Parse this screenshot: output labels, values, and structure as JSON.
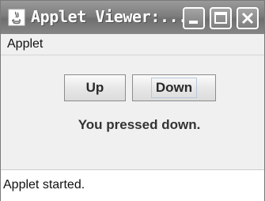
{
  "window": {
    "title": "Applet Viewer:...",
    "controls": {
      "minimize": "minimize-icon",
      "maximize": "maximize-icon",
      "close": "close-icon"
    }
  },
  "menubar": {
    "items": [
      {
        "label": "Applet"
      }
    ]
  },
  "applet": {
    "up_button": "Up",
    "down_button": "Down",
    "message": "You pressed down."
  },
  "status": {
    "text": "Applet started."
  },
  "colors": {
    "titlebar": "#7d7d7d",
    "panel": "#f0f0f0",
    "button_text": "#2a2a2a"
  }
}
